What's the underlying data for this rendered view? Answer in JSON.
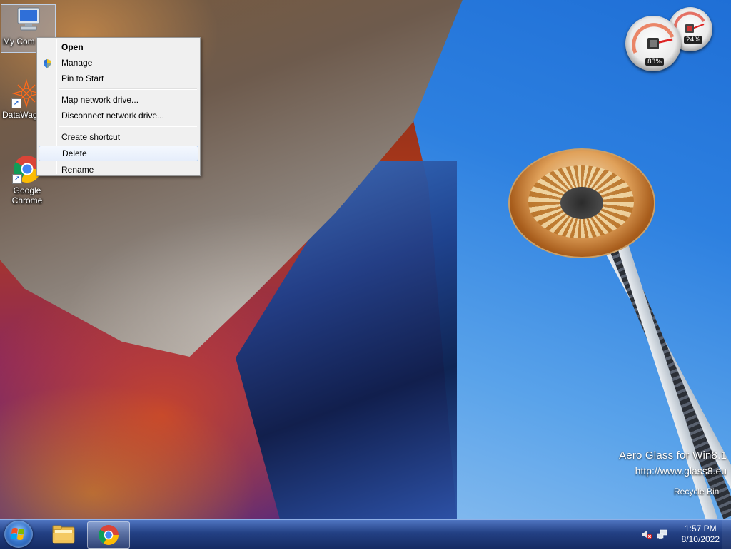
{
  "desktop": {
    "icons": [
      {
        "label": "My Computer",
        "display_label": "My Com",
        "selected": true
      },
      {
        "label": "DataWag",
        "display_label": "DataWag"
      },
      {
        "label": "Google Chrome",
        "display_label": "Google Chrome"
      }
    ],
    "recycle_bin_label": "Recycle Bin",
    "watermark": {
      "line1": "Aero Glass for Win8.1",
      "line2": "http://www.glass8.eu"
    }
  },
  "context_menu": {
    "items": [
      {
        "label": "Open",
        "bold": true
      },
      {
        "label": "Manage",
        "icon": "shield-icon"
      },
      {
        "label": "Pin to Start"
      },
      {
        "separator": true
      },
      {
        "label": "Map network drive..."
      },
      {
        "label": "Disconnect network drive..."
      },
      {
        "separator": true
      },
      {
        "label": "Create shortcut"
      },
      {
        "label": "Delete",
        "hover": true
      },
      {
        "label": "Rename"
      }
    ]
  },
  "gadget": {
    "cpu_percent": "83%",
    "memory_percent": "24%"
  },
  "taskbar": {
    "start_label": "Start",
    "pinned": [
      {
        "name": "File Explorer",
        "icon": "folder-icon"
      },
      {
        "name": "Google Chrome",
        "icon": "chrome-icon",
        "active": true
      }
    ],
    "clock": {
      "time": "1:57 PM",
      "date": "8/10/2022"
    }
  },
  "colors": {
    "menu_hover_border": "#a8c8f0",
    "taskbar_top": "#466ebe",
    "taskbar_bottom": "#102660"
  }
}
